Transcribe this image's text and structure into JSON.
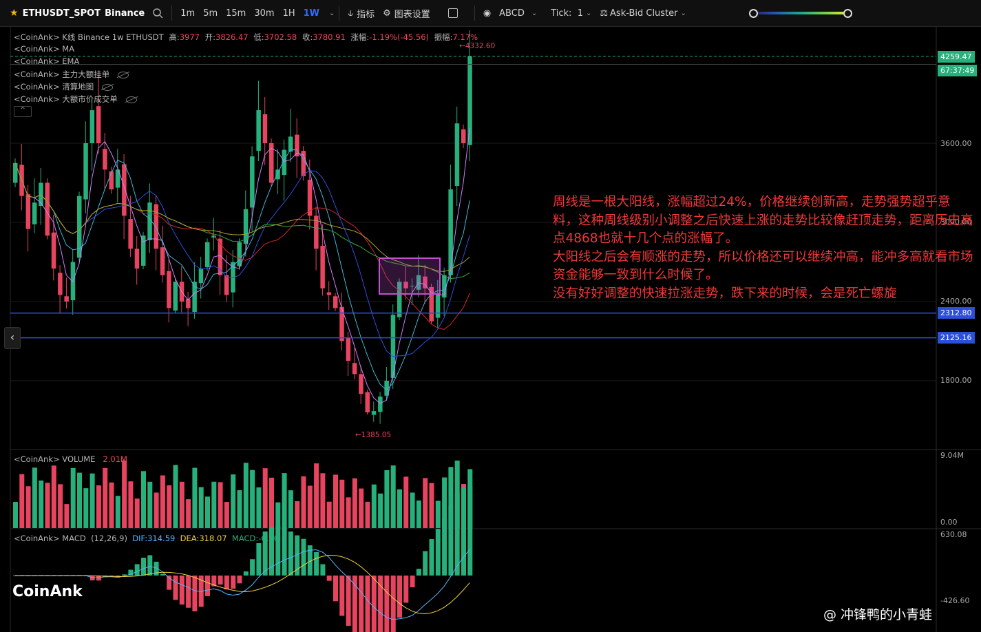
{
  "toolbar": {
    "symbol": "ETHUSDT_SPOT",
    "exchange": "Binance",
    "timeframes": [
      "1m",
      "5m",
      "15m",
      "30m",
      "1H",
      "1W"
    ],
    "active_timeframe": "1W",
    "indicators": "指标",
    "chart_settings": "图表设置",
    "drawing": "ABCD",
    "tick_label": "Tick:",
    "tick_value": "1",
    "cluster": "Ask-Bid Cluster"
  },
  "legend": {
    "main_prefix": "<CoinAnk> K线  Binance 1w ETHUSDT",
    "high_label": "高:",
    "high": "3977",
    "open_label": "开:",
    "open": "3826.47",
    "low_label": "低:",
    "low": "3702.58",
    "close_label": "收:",
    "close": "3780.91",
    "change_label": "涨幅:",
    "change": "-1.19%(-45.56)",
    "amp_label": "振幅:",
    "amp": "7.17%",
    "ma": "<CoinAnk> MA",
    "ema": "<CoinAnk> EMA",
    "big_orders": "<CoinAnk> 主力大额挂单",
    "liq_map": "<CoinAnk> 清算地图",
    "big_trades": "<CoinAnk> 大额市价成交单",
    "volume": "<CoinAnk> VOLUME",
    "volume_value": "2.01M",
    "macd": "<CoinAnk> MACD",
    "macd_params": "(12,26,9)",
    "dif": "DIF:314.59",
    "dea": "DEA:318.07",
    "macd_value": "MACD:-6.96"
  },
  "price_tags": {
    "current": "4259.47",
    "countdown": "67:37:49",
    "line1": "2312.80",
    "line2": "2125.16"
  },
  "axis": {
    "p3600": "3600.00",
    "p3000": "3000.00",
    "p2400": "2400.00",
    "p1800": "1800.00",
    "vol_max": "9.04M",
    "vol_min": "0.00",
    "macd_max": "630.08",
    "macd_min": "-426.60"
  },
  "markers": {
    "high": "←4332.60",
    "low": "←1385.05"
  },
  "annotation": {
    "lines": [
      "周线是一根大阳线，涨幅超过24%，价格继续创新高，走势强势超乎意料，这种周线级别小调整之后快速上涨的走势比较像赶顶走势，距离历史高点4868也就十几个点的涨幅了。",
      "大阳线之后会有顺涨的走势，所以价格还可以继续冲高，能冲多高就看市场资金能够一致到什么时候了。",
      "没有好好调整的快速拉涨走势，跌下来的时候，会是死亡螺旋"
    ]
  },
  "brand": "CoinAnk",
  "watermark": "@ 冲锋鸭的小青蛙",
  "colors": {
    "up": "#26b07c",
    "down": "#e8445f",
    "accent": "#2e6bff",
    "annotation": "#f13838",
    "hline": "#2c4fd8",
    "box": "#c050d0"
  },
  "chart_data": {
    "type": "candlestick",
    "interval": "1w",
    "price_axis_ticks": [
      1800,
      2400,
      3000,
      3600
    ],
    "price_lines": [
      2312.8,
      2125.16
    ],
    "current_price": 4259.47,
    "high_marker": 4332.6,
    "low_marker": 1385.05,
    "closes": [
      3450,
      3200,
      2950,
      3150,
      3300,
      2900,
      2650,
      2450,
      2400,
      2700,
      3200,
      3600,
      3850,
      3600,
      3400,
      3250,
      3400,
      3050,
      2800,
      2650,
      2900,
      3150,
      2800,
      2600,
      2350,
      2550,
      2400,
      2350,
      2550,
      2650,
      2850,
      2900,
      2600,
      2450,
      2700,
      2850,
      3100,
      3500,
      3850,
      3600,
      3300,
      3400,
      3550,
      3650,
      3500,
      3350,
      3050,
      2800,
      2500,
      2450,
      2350,
      2100,
      1950,
      1850,
      1700,
      1560,
      1570,
      1680,
      1800,
      2300,
      2550,
      2500,
      2520,
      2600,
      2500,
      2250,
      2450,
      2600,
      3250,
      3750,
      3600,
      4259.47
    ],
    "volume_max": 9.04,
    "macd_range": [
      -426.6,
      630.08
    ]
  }
}
